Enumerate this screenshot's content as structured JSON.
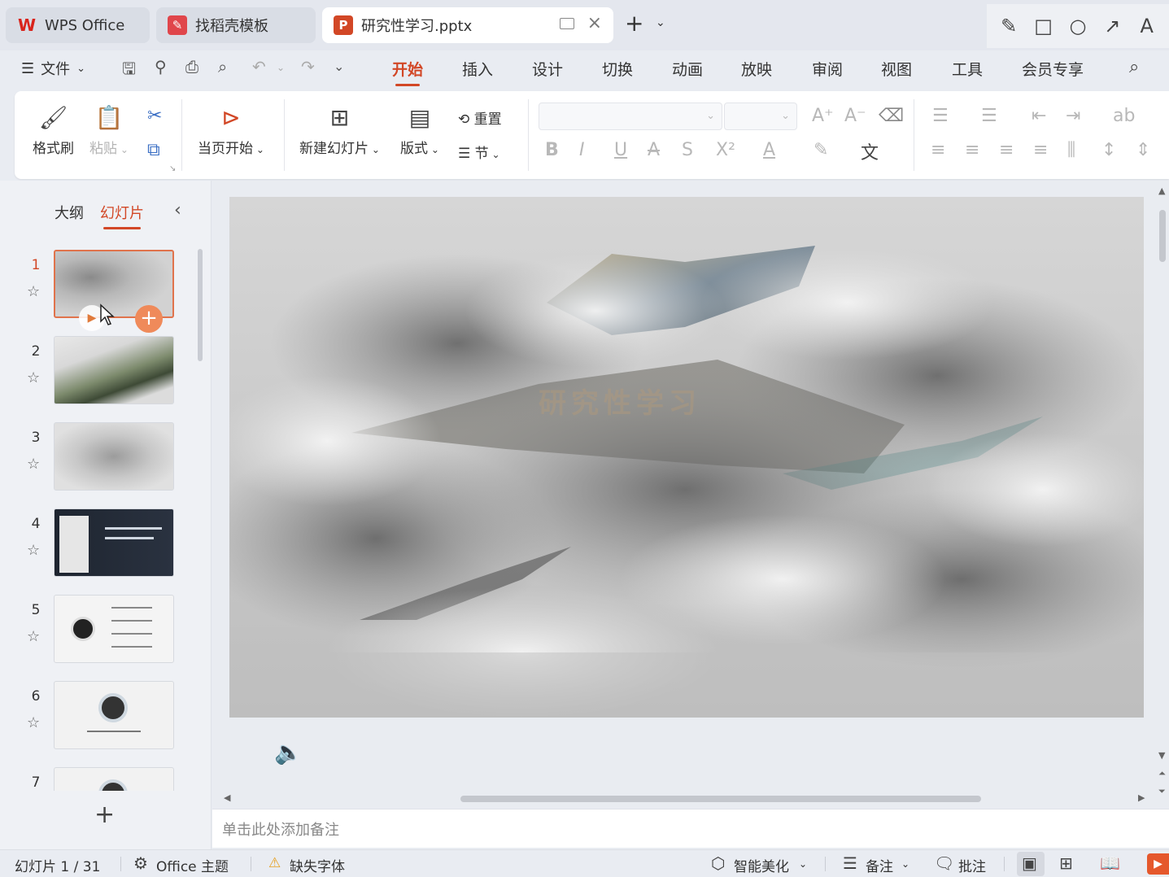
{
  "tabs": [
    {
      "label": "WPS Office",
      "icon": "wps-logo-icon"
    },
    {
      "label": "找稻壳模板",
      "icon": "docer-icon"
    },
    {
      "label": "研究性学习.pptx",
      "icon": "ppt-file-icon",
      "active": true
    }
  ],
  "menu": {
    "file_label": "文件",
    "tabs": [
      "开始",
      "插入",
      "设计",
      "切换",
      "动画",
      "放映",
      "审阅",
      "视图",
      "工具",
      "会员专享"
    ],
    "active_tab": "开始"
  },
  "ribbon": {
    "format_painter": "格式刷",
    "paste": "粘贴",
    "start_from_current": "当页开始",
    "new_slide": "新建幻灯片",
    "layout": "版式",
    "reset": "重置",
    "section": "节"
  },
  "left_pane": {
    "tab_outline": "大纲",
    "tab_slides": "幻灯片",
    "slides": [
      {
        "num": "1",
        "selected": true
      },
      {
        "num": "2"
      },
      {
        "num": "3"
      },
      {
        "num": "4"
      },
      {
        "num": "5"
      },
      {
        "num": "6"
      },
      {
        "num": "7"
      }
    ]
  },
  "notes_placeholder": "单击此处添加备注",
  "status": {
    "slide_counter": "幻灯片 1 / 31",
    "theme": "Office 主题",
    "missing_font": "缺失字体",
    "smart_beautify": "智能美化",
    "notes": "备注",
    "comments": "批注"
  },
  "colors": {
    "accent": "#d24726",
    "ribbon_bg": "#ffffff",
    "chrome_bg": "#e9ecf2"
  }
}
